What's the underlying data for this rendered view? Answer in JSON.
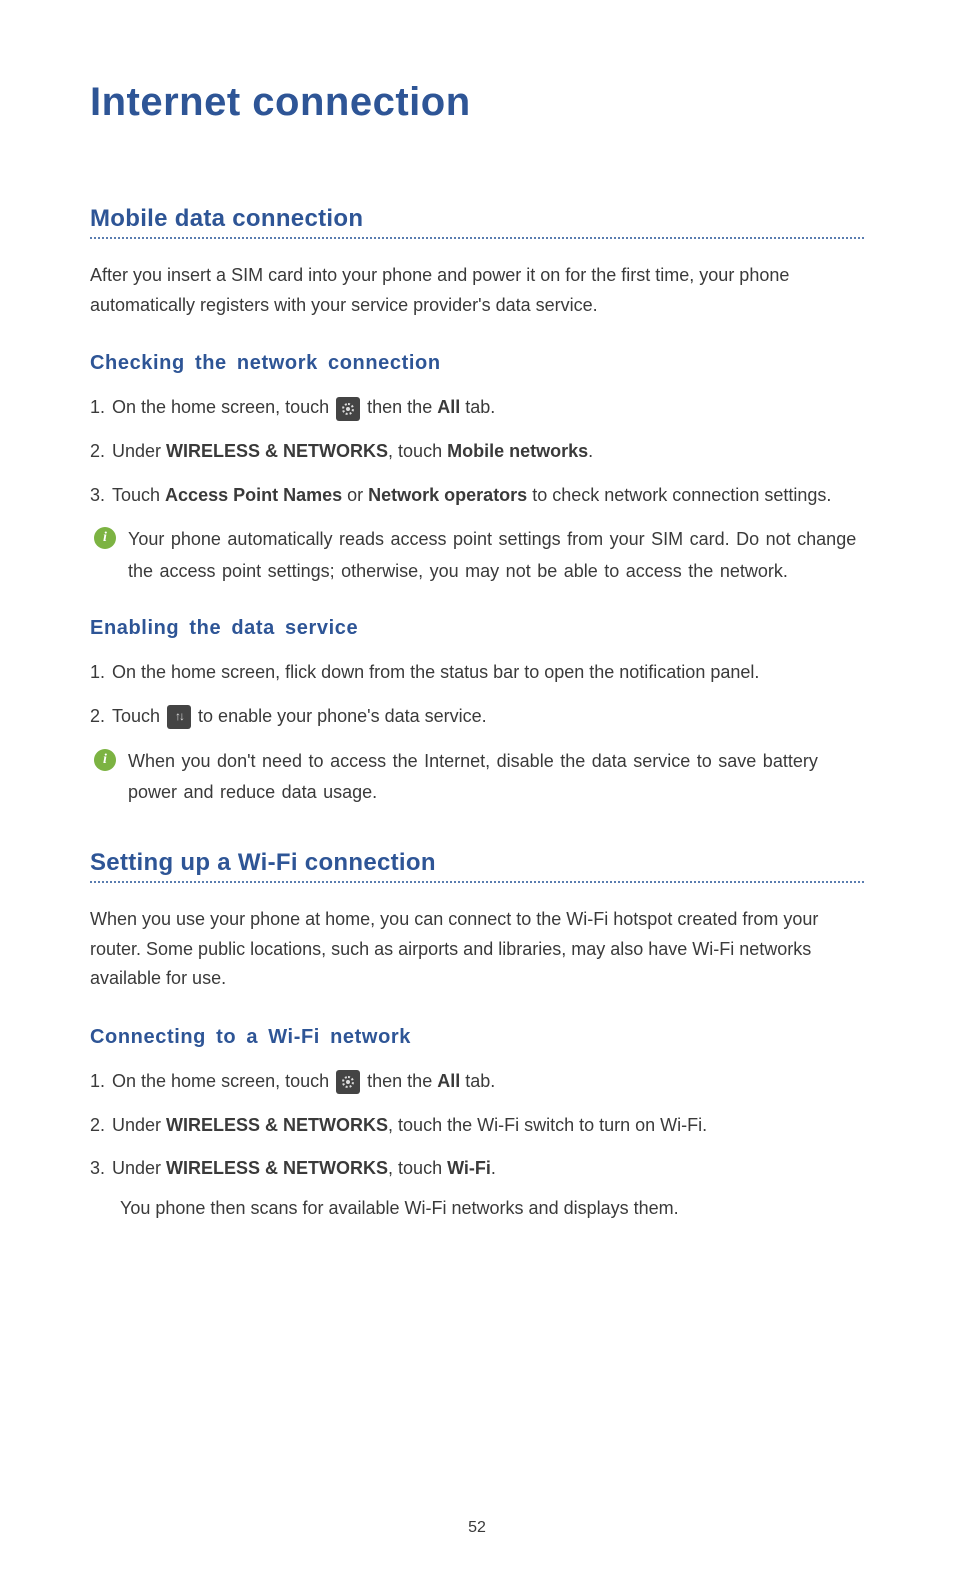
{
  "page_title": "Internet connection",
  "page_number": "52",
  "sections": {
    "mobile_data": {
      "heading": "Mobile data connection",
      "intro": "After you insert a SIM card into your phone and power it on for the first time, your phone automatically registers with your service provider's data service.",
      "checking": {
        "heading": "Checking the network connection",
        "step1a": "On the home screen, touch ",
        "step1b": " then the ",
        "step1c": " tab.",
        "all_word": "All",
        "step2a": "Under ",
        "step2b": ", touch ",
        "step2c": ".",
        "wireless": "WIRELESS & NETWORKS",
        "mobile_networks": "Mobile networks",
        "step3a": "Touch ",
        "step3b": " or ",
        "step3c": " to check network connection settings.",
        "apn": "Access Point Names",
        "network_operators": "Network operators",
        "note": "Your phone automatically reads access point settings from your SIM card. Do not change the access point settings; otherwise, you may not be able to access the network."
      },
      "enabling": {
        "heading": "Enabling the data service",
        "step1": "On the home screen, flick down from the status bar to open the notification panel.",
        "step2a": "Touch ",
        "step2b": " to enable your phone's data service.",
        "note": "When you don't need to access the Internet, disable the data service to save battery power and reduce data usage."
      }
    },
    "wifi": {
      "heading": "Setting up a Wi-Fi connection",
      "intro": "When you use your phone at home, you can connect to the Wi-Fi hotspot created from your router. Some public locations, such as airports and libraries, may also have Wi-Fi networks available for use.",
      "connecting": {
        "heading": "Connecting to a Wi-Fi network",
        "step1a": "On the home screen, touch ",
        "step1b": " then the ",
        "step1c": " tab.",
        "all_word": "All",
        "step2a": "Under ",
        "step2b": ", touch the Wi-Fi switch to turn on Wi-Fi.",
        "wireless": "WIRELESS & NETWORKS",
        "step3a": "Under ",
        "step3b": ", touch ",
        "step3c": ".",
        "wifi_word": "Wi-Fi",
        "step3_after": "You phone then scans for available Wi-Fi networks and displays them."
      }
    }
  }
}
